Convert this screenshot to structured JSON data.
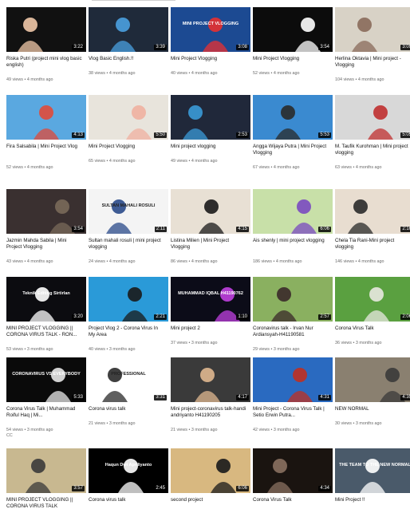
{
  "videos": [
    {
      "title": "Riska Putri (project mini vlog basic english)",
      "meta": "49 views • 4 months ago",
      "duration": "3:22",
      "bg": "#111111",
      "accent": "#f0c8a8"
    },
    {
      "title": "Vlog Basic English.!!",
      "meta": "38 views • 4 months ago",
      "duration": "3:39",
      "bg": "#1f2a3a",
      "accent": "#4aa0e0"
    },
    {
      "title": "Mini Project Vlogging",
      "meta": "40 views • 4 months ago",
      "duration": "3:08",
      "bg": "#1c4a92",
      "accent": "#e83030",
      "overlay": "MINI PROJECT VLOGGING"
    },
    {
      "title": "Mini Project Vlogging",
      "meta": "52 views • 4 months ago",
      "duration": "3:54",
      "bg": "#0c0c0c",
      "accent": "#ffffff"
    },
    {
      "title": "Herlina Oktavia | Mini project - Vlogging",
      "meta": "104 views • 4 months ago",
      "duration": "3:09",
      "bg": "#d8d2c6",
      "accent": "#8a6a5a"
    },
    {
      "title": "Fira Salsabila | Mini Project Vlog",
      "meta": "52 views • 4 months ago",
      "duration": "4:13",
      "bg": "#5aa8e0",
      "accent": "#e04a3a"
    },
    {
      "title": "Mini Project Vlogging",
      "meta": "65 views • 4 months ago",
      "duration": "5:50",
      "bg": "#e8e4dc",
      "accent": "#f0b0a0"
    },
    {
      "title": "Mini project vlogging",
      "meta": "49 views • 4 months ago",
      "duration": "2:53",
      "bg": "#20283a",
      "accent": "#3a9ad8"
    },
    {
      "title": "Angga Wijaya Putra | Mini Project Vlogging",
      "meta": "67 views • 4 months ago",
      "duration": "5:53",
      "bg": "#3a8ad0",
      "accent": "#2a2a2a"
    },
    {
      "title": "M. Taufik Kurohman | Mini project vlogging",
      "meta": "63 views • 4 months ago",
      "duration": "5:05",
      "bg": "#d8d8d8",
      "accent": "#c03030"
    },
    {
      "title": "Jazmin Mahda Sabila | Mini Project Vlogging",
      "meta": "43 views • 4 months ago",
      "duration": "3:54",
      "bg": "#3a3030",
      "accent": "#7a6a5a"
    },
    {
      "title": "Sultan mahali rosuli | mini project vlogging",
      "meta": "24 views • 4 months ago",
      "duration": "2:11",
      "bg": "#f4f4f4",
      "accent": "#2a4a8a",
      "overlay": "SULTAN MAHALI ROSULI"
    },
    {
      "title": "Listina Milien | Mini Project Vlogging",
      "meta": "86 views • 4 months ago",
      "duration": "4:15",
      "bg": "#e8e0d4",
      "accent": "#1a1a1a"
    },
    {
      "title": "Ais shenly | mini project vlogging",
      "meta": "186 views • 4 months ago",
      "duration": "6:06",
      "bg": "#c8e0a8",
      "accent": "#7a4ac0"
    },
    {
      "title": "Chela Tia Rani-Mini project vlogging",
      "meta": "146 views • 4 months ago",
      "duration": "2:16",
      "bg": "#e8ddd0",
      "accent": "#2a2a2a"
    },
    {
      "title": "MINI PROJECT VLOGGING || CORONA VIRUS TALK - RON...",
      "meta": "53 views • 3 months ago",
      "duration": "3:20",
      "bg": "#0c0c10",
      "accent": "#ffffff",
      "overlay": "Teknik Editing Sirtirlan"
    },
    {
      "title": "Project Vlog 2 - Corona Virus In My Area",
      "meta": "40 views • 3 months ago",
      "duration": "2:21",
      "bg": "#2a9ad8",
      "accent": "#1a1a1a"
    },
    {
      "title": "Mini project 2",
      "meta": "37 views • 3 months ago",
      "duration": "1:10",
      "bg": "#0c0c18",
      "accent": "#c040e0",
      "overlay": "MUHAMMAD IQBAL H41190762"
    },
    {
      "title": "Coronavirus talk - Irvan Nur Ardiansyah-H41190581",
      "meta": "29 views • 3 months ago",
      "duration": "2:57",
      "bg": "#8ab060",
      "accent": "#3a2a2a"
    },
    {
      "title": "Corona Virus Talk",
      "meta": "36 views • 3 months ago",
      "duration": "2:06",
      "bg": "#5aa040",
      "accent": "#e8e8e0"
    },
    {
      "title": "Corona Virus Talk | Muhammad Roiful Haq | Mi...",
      "meta": "54 views • 3 months ago",
      "duration": "5:33",
      "bg": "#0a0a0a",
      "accent": "#e8e8e8",
      "overlay": "CORONAVIRUS VS EVERYBODY",
      "cc": "CC"
    },
    {
      "title": "Corona virus talk",
      "meta": "21 views • 3 months ago",
      "duration": "3:31",
      "bg": "#ffffff",
      "accent": "#2a2a2a",
      "overlay": "PROFESSIONAL"
    },
    {
      "title": "Mini project-coronavirus talk-handi andriyanto H41190205",
      "meta": "21 views • 3 months ago",
      "duration": "4:17",
      "bg": "#3a3a3a",
      "accent": "#e0b890"
    },
    {
      "title": "Mini Project - Corona Virus Talk | Setio Erwin Putra...",
      "meta": "42 views • 3 months ago",
      "duration": "4:31",
      "bg": "#2a6ac0",
      "accent": "#c03020"
    },
    {
      "title": "NEW NORMAL",
      "meta": "30 views • 3 months ago",
      "duration": "4:35",
      "bg": "#8a8070",
      "accent": "#3a3a3a"
    },
    {
      "title": "MINI PROJECT VLOGGING || CORONA VIRUS TALK",
      "meta": "",
      "duration": "3:57",
      "bg": "#c8b890",
      "accent": "#3a3a3a"
    },
    {
      "title": "Corona virus talk",
      "meta": "",
      "duration": "2:45",
      "bg": "#000000",
      "accent": "#ffffff",
      "overlay": "Haqun Dwi Apriliyanto"
    },
    {
      "title": "second project",
      "meta": "",
      "duration": "6:06",
      "bg": "#d8b880",
      "accent": "#1a1a1a"
    },
    {
      "title": "Corona Virus Talk",
      "meta": "",
      "duration": "4:34",
      "bg": "#1a1410",
      "accent": "#8a7060"
    },
    {
      "title": "Mini Project !!",
      "meta": "",
      "duration": "",
      "bg": "#4a5a6a",
      "accent": "#ffffff",
      "overlay": "THE TEAM TO THE NEW NORMAL"
    }
  ]
}
